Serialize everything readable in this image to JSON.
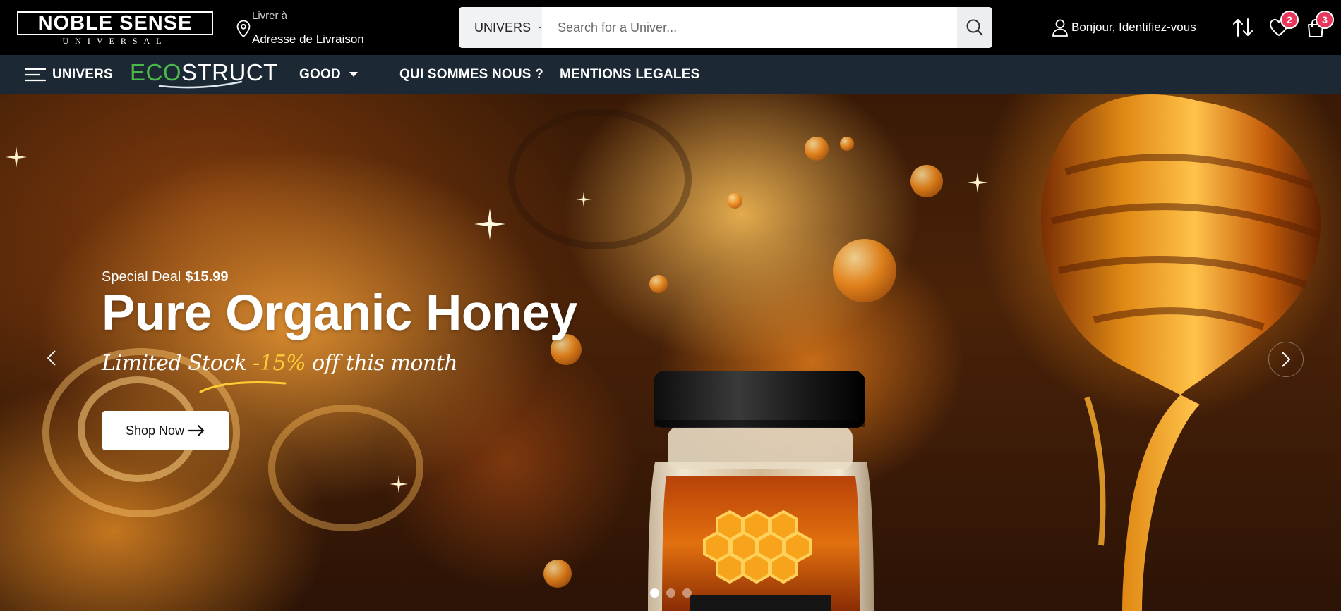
{
  "header": {
    "logo": {
      "main": "NOBLE SENSE",
      "sub": "UNIVERSAL"
    },
    "delivery": {
      "small_label": "Livrer à",
      "address_label": "Adresse de Livraison"
    },
    "search": {
      "category": "UNIVERS",
      "placeholder": "Search for a Univer..."
    },
    "account": {
      "label": "Bonjour, Identifiez-vous"
    },
    "wishlist": {
      "count": "2"
    },
    "cart": {
      "count": "3"
    }
  },
  "nav": {
    "menu_label": "UNIVERS",
    "brand": {
      "part1": "ECO",
      "part2": "STRUCT"
    },
    "items": [
      {
        "label": "GOOD"
      },
      {
        "label": "QUI SOMMES NOUS ?"
      },
      {
        "label": "MENTIONS LEGALES"
      }
    ]
  },
  "hero": {
    "deal_label": "Special Deal",
    "deal_price": "$15.99",
    "title": "Pure Organic Honey",
    "subtitle_part1": "Limited Stock ",
    "subtitle_highlight": "-15%",
    "subtitle_part2": " off this month",
    "cta_label": "Shop Now",
    "slides": 3,
    "active_slide": 1
  },
  "colors": {
    "header_bg": "#000000",
    "nav_bg": "#1c2833",
    "brand_green": "#4bb84b",
    "badge": "#e8375d",
    "highlight": "#ffcc33"
  }
}
